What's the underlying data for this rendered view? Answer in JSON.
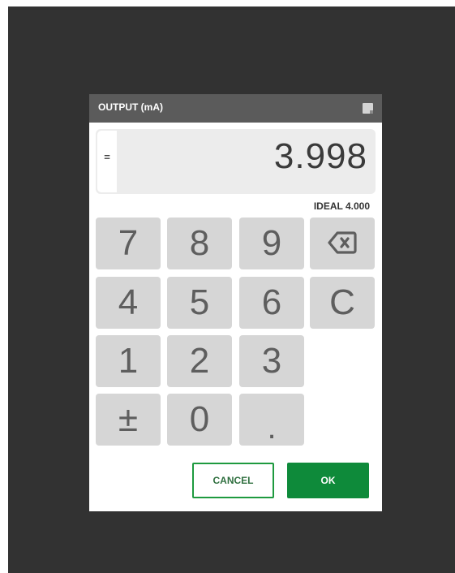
{
  "dialog": {
    "title": "OUTPUT (mA)",
    "operator": "=",
    "value": "3.998",
    "ideal": "IDEAL 4.000"
  },
  "keypad": {
    "k7": "7",
    "k8": "8",
    "k9": "9",
    "k4": "4",
    "k5": "5",
    "k6": "6",
    "k1": "1",
    "k2": "2",
    "k3": "3",
    "kpm": "±",
    "k0": "0",
    "kdot": ".",
    "clear": "C",
    "backspace_icon": "backspace-icon"
  },
  "buttons": {
    "cancel": "CANCEL",
    "ok": "OK"
  },
  "colors": {
    "accent": "#0e8a3a",
    "key_bg": "#d6d6d6",
    "title_bg": "#5b5b5b",
    "backdrop": "#323232"
  }
}
